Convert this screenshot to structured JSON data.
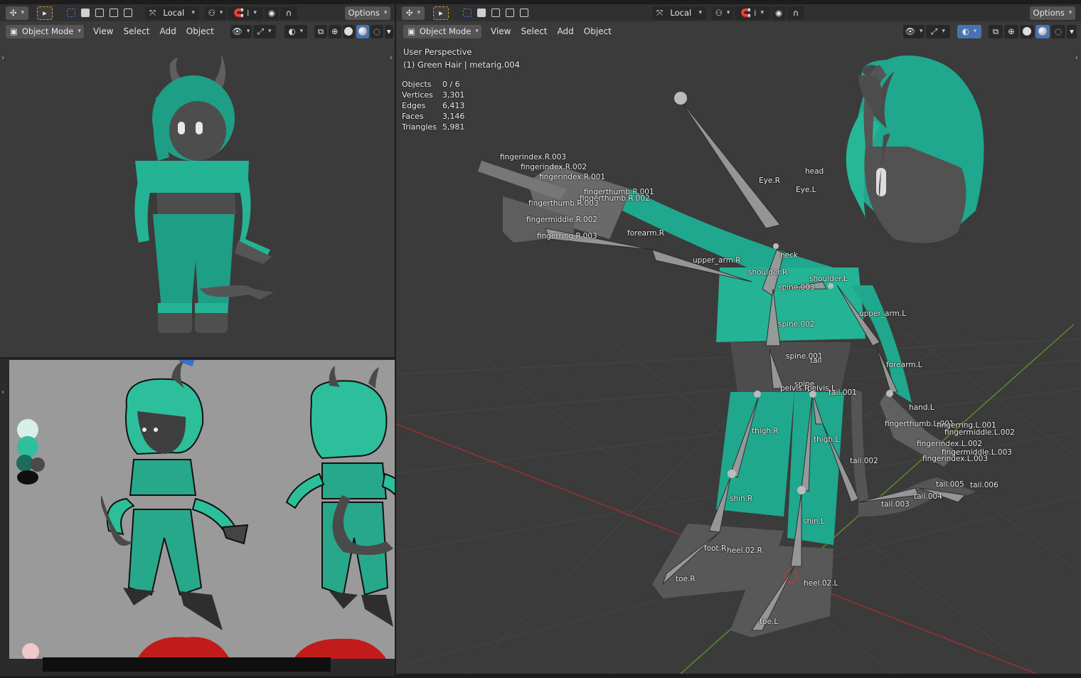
{
  "left_viewport": {
    "orientation": "Local",
    "options_label": "Options",
    "mode_label": "Object Mode",
    "menu": [
      "View",
      "Select",
      "Add",
      "Object"
    ]
  },
  "right_viewport": {
    "orientation": "Local",
    "options_label": "Options",
    "mode_label": "Object Mode",
    "menu": [
      "View",
      "Select",
      "Add",
      "Object"
    ],
    "perspective_label": "User Perspective",
    "active_object": "(1) Green Hair | metarig.004",
    "stats": [
      {
        "label": "Objects",
        "value": "0 / 6"
      },
      {
        "label": "Vertices",
        "value": "3,301"
      },
      {
        "label": "Edges",
        "value": "6,413"
      },
      {
        "label": "Faces",
        "value": "3,146"
      },
      {
        "label": "Triangles",
        "value": "5,981"
      }
    ],
    "bones": [
      "fingerindex.R.003",
      "fingerindex.R.002",
      "fingerindex.R.001",
      "fingerthumb.R.001",
      "fingerthumb.R.002",
      "fingerthumb.R.003",
      "fingermiddle.R.002",
      "fingerring.R.003",
      "forearm.R",
      "upper_arm.R",
      "shoulder.R",
      "neck",
      "head",
      "Eye.R",
      "Eye.L",
      "shoulder.L",
      "spine.003",
      "upper_arm.L",
      "spine.002",
      "forearm.L",
      "spine.001",
      "tail",
      "spine",
      "pelvis.R",
      "pelvis.L",
      "tail.001",
      "hand.L",
      "thigh.R",
      "thigh.L",
      "fingerthumb.L.001",
      "fingerring.L.001",
      "fingermiddle.L.002",
      "fingerindex.L.002",
      "fingerindex.L.003",
      "fingermiddle.L.003",
      "tail.002",
      "tail.005",
      "tail.006",
      "tail.004",
      "tail.003",
      "shin.R",
      "shin.L",
      "foot.R",
      "heel.02.R",
      "heel.02.L",
      "toe.R",
      "toe.L"
    ]
  },
  "colors": {
    "teal": "#1fa88d",
    "teal_light": "#2cc7a4",
    "body_gray": "#5a5a5a",
    "accent_blue": "#4772b3"
  }
}
